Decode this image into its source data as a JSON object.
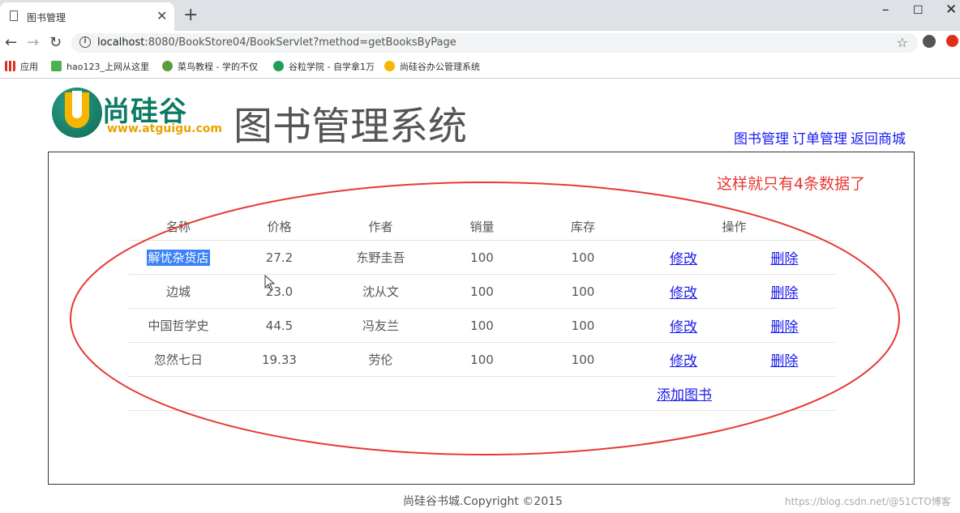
{
  "browser": {
    "tab_title": "图书管理",
    "tab_close": "✕",
    "new_tab": "+",
    "minimize": "–",
    "maximize": "☐",
    "close": "✕",
    "back": "←",
    "forward": "→",
    "reload": "↻",
    "url_host": "localhost",
    "url_rest": ":8080/BookStore04/BookServlet?method=getBooksByPage",
    "bookmarks": [
      {
        "label": "应用",
        "icon_color": "#d93025"
      },
      {
        "label": "hao123_上网从这里",
        "icon_color": "#4caf50"
      },
      {
        "label": "菜鸟教程 - 学的不仅",
        "icon_color": "#5a9e3a"
      },
      {
        "label": "谷粒学院 - 自学拿1万",
        "icon_color": "#1e9e5a"
      },
      {
        "label": "尚硅谷办公管理系统",
        "icon_color": "#f7b500"
      }
    ]
  },
  "header": {
    "logo_text": "尚硅谷",
    "logo_url": "www.atguigu.com",
    "system_title": "图书管理系统",
    "nav": [
      "图书管理",
      "订单管理",
      "返回商城"
    ]
  },
  "annotation": "这样就只有4条数据了",
  "table": {
    "columns": [
      "名称",
      "价格",
      "作者",
      "销量",
      "库存",
      "操作"
    ],
    "rows": [
      {
        "name": "解忧杂货店",
        "price": "27.2",
        "author": "东野圭吾",
        "sales": "100",
        "stock": "100"
      },
      {
        "name": "边城",
        "price": "23.0",
        "author": "沈从文",
        "sales": "100",
        "stock": "100"
      },
      {
        "name": "中国哲学史",
        "price": "44.5",
        "author": "冯友兰",
        "sales": "100",
        "stock": "100"
      },
      {
        "name": "忽然七日",
        "price": "19.33",
        "author": "劳伦",
        "sales": "100",
        "stock": "100"
      }
    ],
    "edit_label": "修改",
    "delete_label": "删除",
    "add_label": "添加图书"
  },
  "footer": "尚硅谷书城.Copyright ©2015",
  "watermark": "https://blog.csdn.net/@51CTO博客",
  "colors": {
    "annotation": "#e53935",
    "link": "#1a1aee",
    "selection": "#3b82f6"
  }
}
